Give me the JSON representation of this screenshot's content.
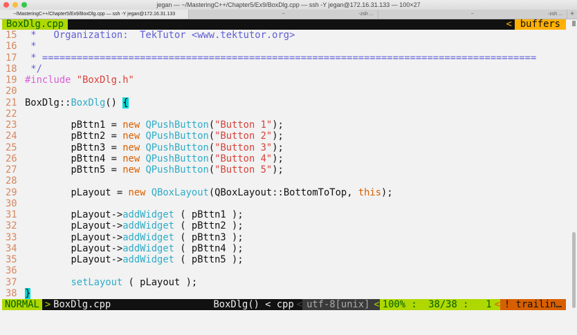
{
  "window": {
    "title": "jegan — ~/MasteringC++/Chapter5/Ex9/BoxDlg.cpp — ssh -Y jegan@172.16.31.133 — 100×27"
  },
  "tabs": [
    {
      "label": "~/MasteringC++/Chapter5/Ex9/BoxDlg.cpp — ssh -Y jegan@172.16.31.133",
      "right": ""
    },
    {
      "label": "~",
      "right": "-zsh ..."
    },
    {
      "label": "~",
      "right": "-zsh ..."
    }
  ],
  "tabline": {
    "file": "BoxDlg.cpp",
    "arrow": "<",
    "buffers": "buffers"
  },
  "lines": [
    {
      "n": "15",
      "segs": [
        [
          "c",
          " *   Organization:  TekTutor <www.tektutor.org>"
        ]
      ]
    },
    {
      "n": "16",
      "segs": [
        [
          "c",
          " *"
        ]
      ]
    },
    {
      "n": "17",
      "segs": [
        [
          "c",
          " * ======================================================================================"
        ]
      ]
    },
    {
      "n": "18",
      "segs": [
        [
          "c",
          " */"
        ]
      ]
    },
    {
      "n": "19",
      "segs": [
        [
          "p",
          "#include "
        ],
        [
          "s",
          "\"BoxDlg.h\""
        ]
      ]
    },
    {
      "n": "20",
      "segs": []
    },
    {
      "n": "21",
      "segs": [
        [
          "t",
          "BoxDlg::"
        ],
        [
          "f",
          "BoxDlg"
        ],
        [
          "t",
          "() "
        ],
        [
          "cur",
          "{"
        ]
      ]
    },
    {
      "n": "22",
      "segs": []
    },
    {
      "n": "23",
      "segs": [
        [
          "t",
          "        pBttn1 = "
        ],
        [
          "k",
          "new "
        ],
        [
          "f",
          "QPushButton"
        ],
        [
          "t",
          "("
        ],
        [
          "s",
          "\"Button 1\""
        ],
        [
          "t",
          ");"
        ]
      ]
    },
    {
      "n": "24",
      "segs": [
        [
          "t",
          "        pBttn2 = "
        ],
        [
          "k",
          "new "
        ],
        [
          "f",
          "QPushButton"
        ],
        [
          "t",
          "("
        ],
        [
          "s",
          "\"Button 2\""
        ],
        [
          "t",
          ");"
        ]
      ]
    },
    {
      "n": "25",
      "segs": [
        [
          "t",
          "        pBttn3 = "
        ],
        [
          "k",
          "new "
        ],
        [
          "f",
          "QPushButton"
        ],
        [
          "t",
          "("
        ],
        [
          "s",
          "\"Button 3\""
        ],
        [
          "t",
          ");"
        ]
      ]
    },
    {
      "n": "26",
      "segs": [
        [
          "t",
          "        pBttn4 = "
        ],
        [
          "k",
          "new "
        ],
        [
          "f",
          "QPushButton"
        ],
        [
          "t",
          "("
        ],
        [
          "s",
          "\"Button 4\""
        ],
        [
          "t",
          ");"
        ]
      ]
    },
    {
      "n": "27",
      "segs": [
        [
          "t",
          "        pBttn5 = "
        ],
        [
          "k",
          "new "
        ],
        [
          "f",
          "QPushButton"
        ],
        [
          "t",
          "("
        ],
        [
          "s",
          "\"Button 5\""
        ],
        [
          "t",
          ");"
        ]
      ]
    },
    {
      "n": "28",
      "segs": []
    },
    {
      "n": "29",
      "segs": [
        [
          "t",
          "        pLayout = "
        ],
        [
          "k",
          "new "
        ],
        [
          "f",
          "QBoxLayout"
        ],
        [
          "t",
          "(QBoxLayout::BottomToTop, "
        ],
        [
          "k",
          "this"
        ],
        [
          "t",
          ");"
        ]
      ]
    },
    {
      "n": "30",
      "segs": []
    },
    {
      "n": "31",
      "segs": [
        [
          "t",
          "        pLayout->"
        ],
        [
          "f",
          "addWidget"
        ],
        [
          "t",
          " ( pBttn1 );"
        ]
      ]
    },
    {
      "n": "32",
      "segs": [
        [
          "t",
          "        pLayout->"
        ],
        [
          "f",
          "addWidget"
        ],
        [
          "t",
          " ( pBttn2 );"
        ]
      ]
    },
    {
      "n": "33",
      "segs": [
        [
          "t",
          "        pLayout->"
        ],
        [
          "f",
          "addWidget"
        ],
        [
          "t",
          " ( pBttn3 );"
        ]
      ]
    },
    {
      "n": "34",
      "segs": [
        [
          "t",
          "        pLayout->"
        ],
        [
          "f",
          "addWidget"
        ],
        [
          "t",
          " ( pBttn4 );"
        ]
      ]
    },
    {
      "n": "35",
      "segs": [
        [
          "t",
          "        pLayout->"
        ],
        [
          "f",
          "addWidget"
        ],
        [
          "t",
          " ( pBttn5 );"
        ]
      ]
    },
    {
      "n": "36",
      "segs": []
    },
    {
      "n": "37",
      "segs": [
        [
          "t",
          "        "
        ],
        [
          "f",
          "setLayout"
        ],
        [
          "t",
          " ( pLayout );"
        ]
      ]
    },
    {
      "n": "38",
      "segs": [
        [
          "cur",
          "}"
        ]
      ]
    }
  ],
  "status": {
    "mode": "NORMAL",
    "sep1": ">",
    "file": "BoxDlg.cpp",
    "func": "BoxDlg() < cpp",
    "sep2": "<",
    "encoding": "utf-8[unix]",
    "sep3": "<",
    "position": "100% :  38/38 :   1",
    "sep4": "<",
    "warning": "! trailin…"
  }
}
